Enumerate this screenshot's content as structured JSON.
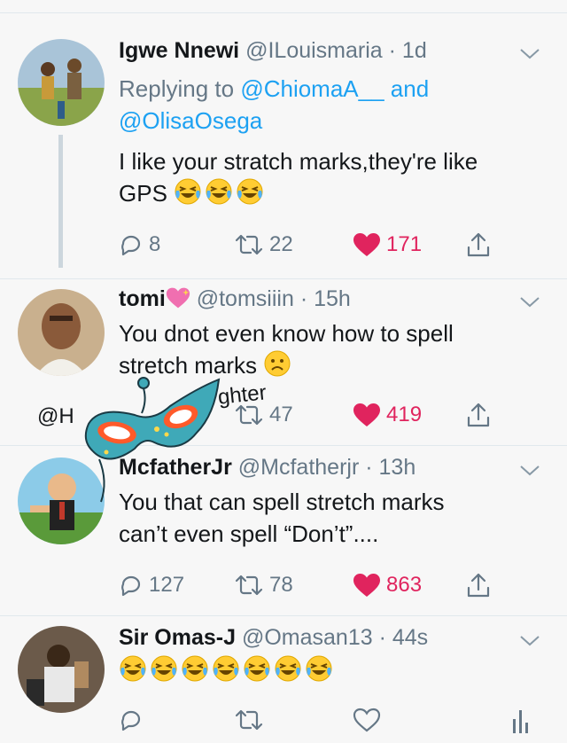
{
  "tweets": [
    {
      "name": "Igwe Nnewi",
      "handle": "@ILouismaria",
      "time": "· 1d",
      "reply_prefix": "Replying to",
      "reply_user1": "@ChiomaA__",
      "reply_and": "and",
      "reply_user2": "@OlisaOsega",
      "text_line1": "I like your stratch marks,they're like",
      "text_line2": "GPS",
      "replies": "8",
      "retweets": "22",
      "likes": "171"
    },
    {
      "name": "tomi",
      "handle": "@tomsiiin",
      "time": "· 15h",
      "text_line1": "You dnot even know how to spell",
      "text_line2": "stretch marks",
      "overlay_left": "@H",
      "overlay_right": "ghter",
      "retweets": "47",
      "likes": "419"
    },
    {
      "name": "McfatherJr",
      "handle": "@Mcfatherjr",
      "time": "· 13h",
      "text_line1": "You that can spell stretch marks",
      "text_line2": "can’t even spell “Don’t”....",
      "replies": "127",
      "retweets": "78",
      "likes": "863"
    },
    {
      "name": "Sir Omas-J",
      "handle": "@Omasan13",
      "time": "· 44s"
    }
  ],
  "colors": {
    "like": "#e0245e",
    "link": "#1da1f2",
    "muted": "#657786"
  },
  "icons": [
    "reply-icon",
    "retweet-icon",
    "heart-icon",
    "share-icon",
    "chevron-down-icon",
    "laughing-emoji",
    "frown-emoji",
    "analytics-icon",
    "carnival-mask-sticker"
  ]
}
